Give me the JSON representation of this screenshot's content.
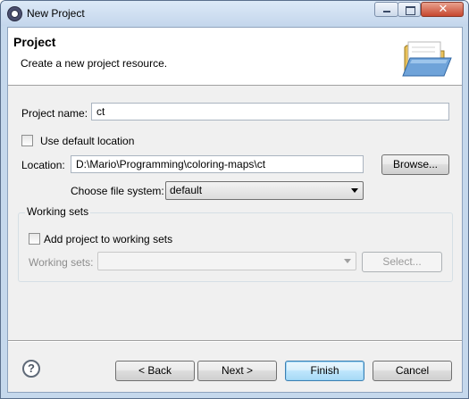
{
  "window": {
    "title": "New Project",
    "close_glyph": "✕"
  },
  "banner": {
    "title": "Project",
    "description": "Create a new project resource.",
    "icon": "folder-open-icon"
  },
  "form": {
    "project_name_label": "Project name:",
    "project_name_value": "ct",
    "use_default_location_label": "Use default location",
    "use_default_location_checked": false,
    "location_label": "Location:",
    "location_value": "D:\\Mario\\Programming\\coloring-maps\\ct",
    "browse_label": "Browse...",
    "file_system_label": "Choose file system:",
    "file_system_value": "default"
  },
  "working_sets": {
    "group_title": "Working sets",
    "add_label": "Add project to working sets",
    "add_checked": false,
    "sets_label": "Working sets:",
    "sets_value": "",
    "select_label": "Select..."
  },
  "footer": {
    "help_glyph": "?",
    "back_label": "< Back",
    "next_label": "Next >",
    "finish_label": "Finish",
    "cancel_label": "Cancel"
  }
}
